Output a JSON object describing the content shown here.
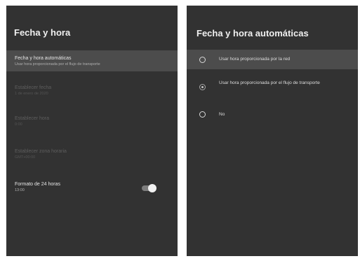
{
  "left_panel": {
    "title": "Fecha y hora",
    "items": [
      {
        "title": "Fecha y hora automáticas",
        "subtitle": "Usar hora proporcionada por el flujo de transporte",
        "selected": true,
        "enabled": true
      },
      {
        "title": "Establecer fecha",
        "subtitle": "1 de enero de 2020",
        "selected": false,
        "enabled": false
      },
      {
        "title": "Establecer hora",
        "subtitle": "0:00",
        "selected": false,
        "enabled": false
      },
      {
        "title": "Establecer zona horaria",
        "subtitle": "GMT+00:00",
        "selected": false,
        "enabled": false
      },
      {
        "title": "Formato de 24 horas",
        "subtitle": "13:00",
        "selected": false,
        "enabled": true,
        "toggle_on": true
      }
    ]
  },
  "right_panel": {
    "title": "Fecha y hora automáticas",
    "options": [
      {
        "label": "Usar hora proporcionada por la red",
        "checked": false,
        "highlighted": true
      },
      {
        "label": "Usar hora proporcionada por el flujo de transporte",
        "checked": true,
        "highlighted": false
      },
      {
        "label": "No",
        "checked": false,
        "highlighted": false
      }
    ]
  },
  "colors": {
    "screen_background": "#323232",
    "highlight_background": "#4c4c4c",
    "disabled_text": "#5e5e5e"
  }
}
